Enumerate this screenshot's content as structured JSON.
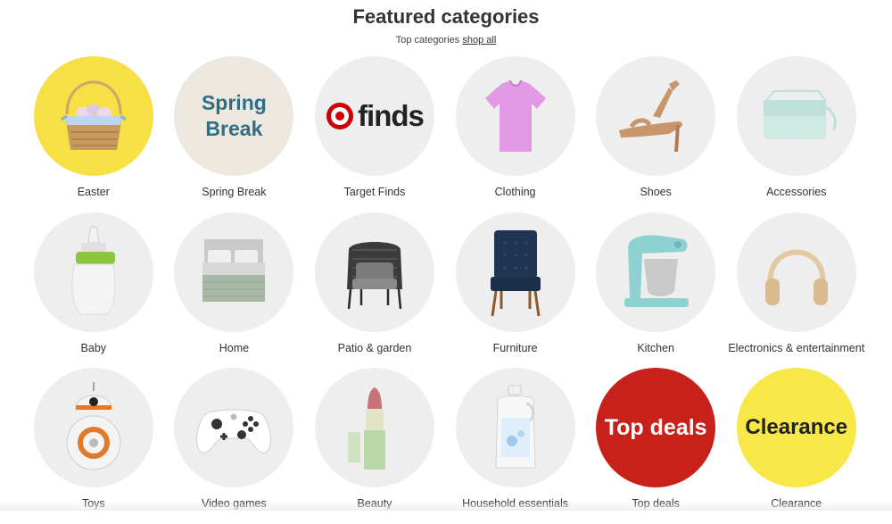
{
  "header": {
    "title": "Featured categories",
    "subtitle_prefix": "Top categories",
    "shop_all": "shop all"
  },
  "tiles": {
    "easter": {
      "label": "Easter",
      "icon": "easter-basket-icon"
    },
    "spring_break": {
      "label": "Spring Break",
      "art_line1": "Spring",
      "art_line2": "Break"
    },
    "target_finds": {
      "label": "Target Finds",
      "art_text": "finds",
      "icon": "target-bullseye-icon"
    },
    "clothing": {
      "label": "Clothing",
      "icon": "t-shirt-icon"
    },
    "shoes": {
      "label": "Shoes",
      "icon": "sandal-icon"
    },
    "accessories": {
      "label": "Accessories",
      "icon": "handbag-icon"
    },
    "baby": {
      "label": "Baby",
      "icon": "baby-bottle-icon"
    },
    "home": {
      "label": "Home",
      "icon": "bed-icon"
    },
    "patio": {
      "label": "Patio & garden",
      "icon": "patio-chair-icon"
    },
    "furniture": {
      "label": "Furniture",
      "icon": "accent-chair-icon"
    },
    "kitchen": {
      "label": "Kitchen",
      "icon": "stand-mixer-icon"
    },
    "electronics": {
      "label": "Electronics & entertainment",
      "icon": "headphones-icon"
    },
    "toys": {
      "label": "Toys",
      "icon": "robot-toy-icon"
    },
    "video_games": {
      "label": "Video games",
      "icon": "game-controller-icon"
    },
    "beauty": {
      "label": "Beauty",
      "icon": "lipstick-icon"
    },
    "household": {
      "label": "Household essentials",
      "icon": "detergent-bottle-icon"
    },
    "top_deals": {
      "label": "Top deals",
      "art_text": "Top deals"
    },
    "clearance": {
      "label": "Clearance",
      "art_text": "Clearance"
    }
  },
  "colors": {
    "tile_bg": "#eeeeee",
    "easter_bg": "#f6e046",
    "top_deals_bg": "#c8201b",
    "clearance_bg": "#f7e848",
    "brand_red": "#cc0000"
  }
}
